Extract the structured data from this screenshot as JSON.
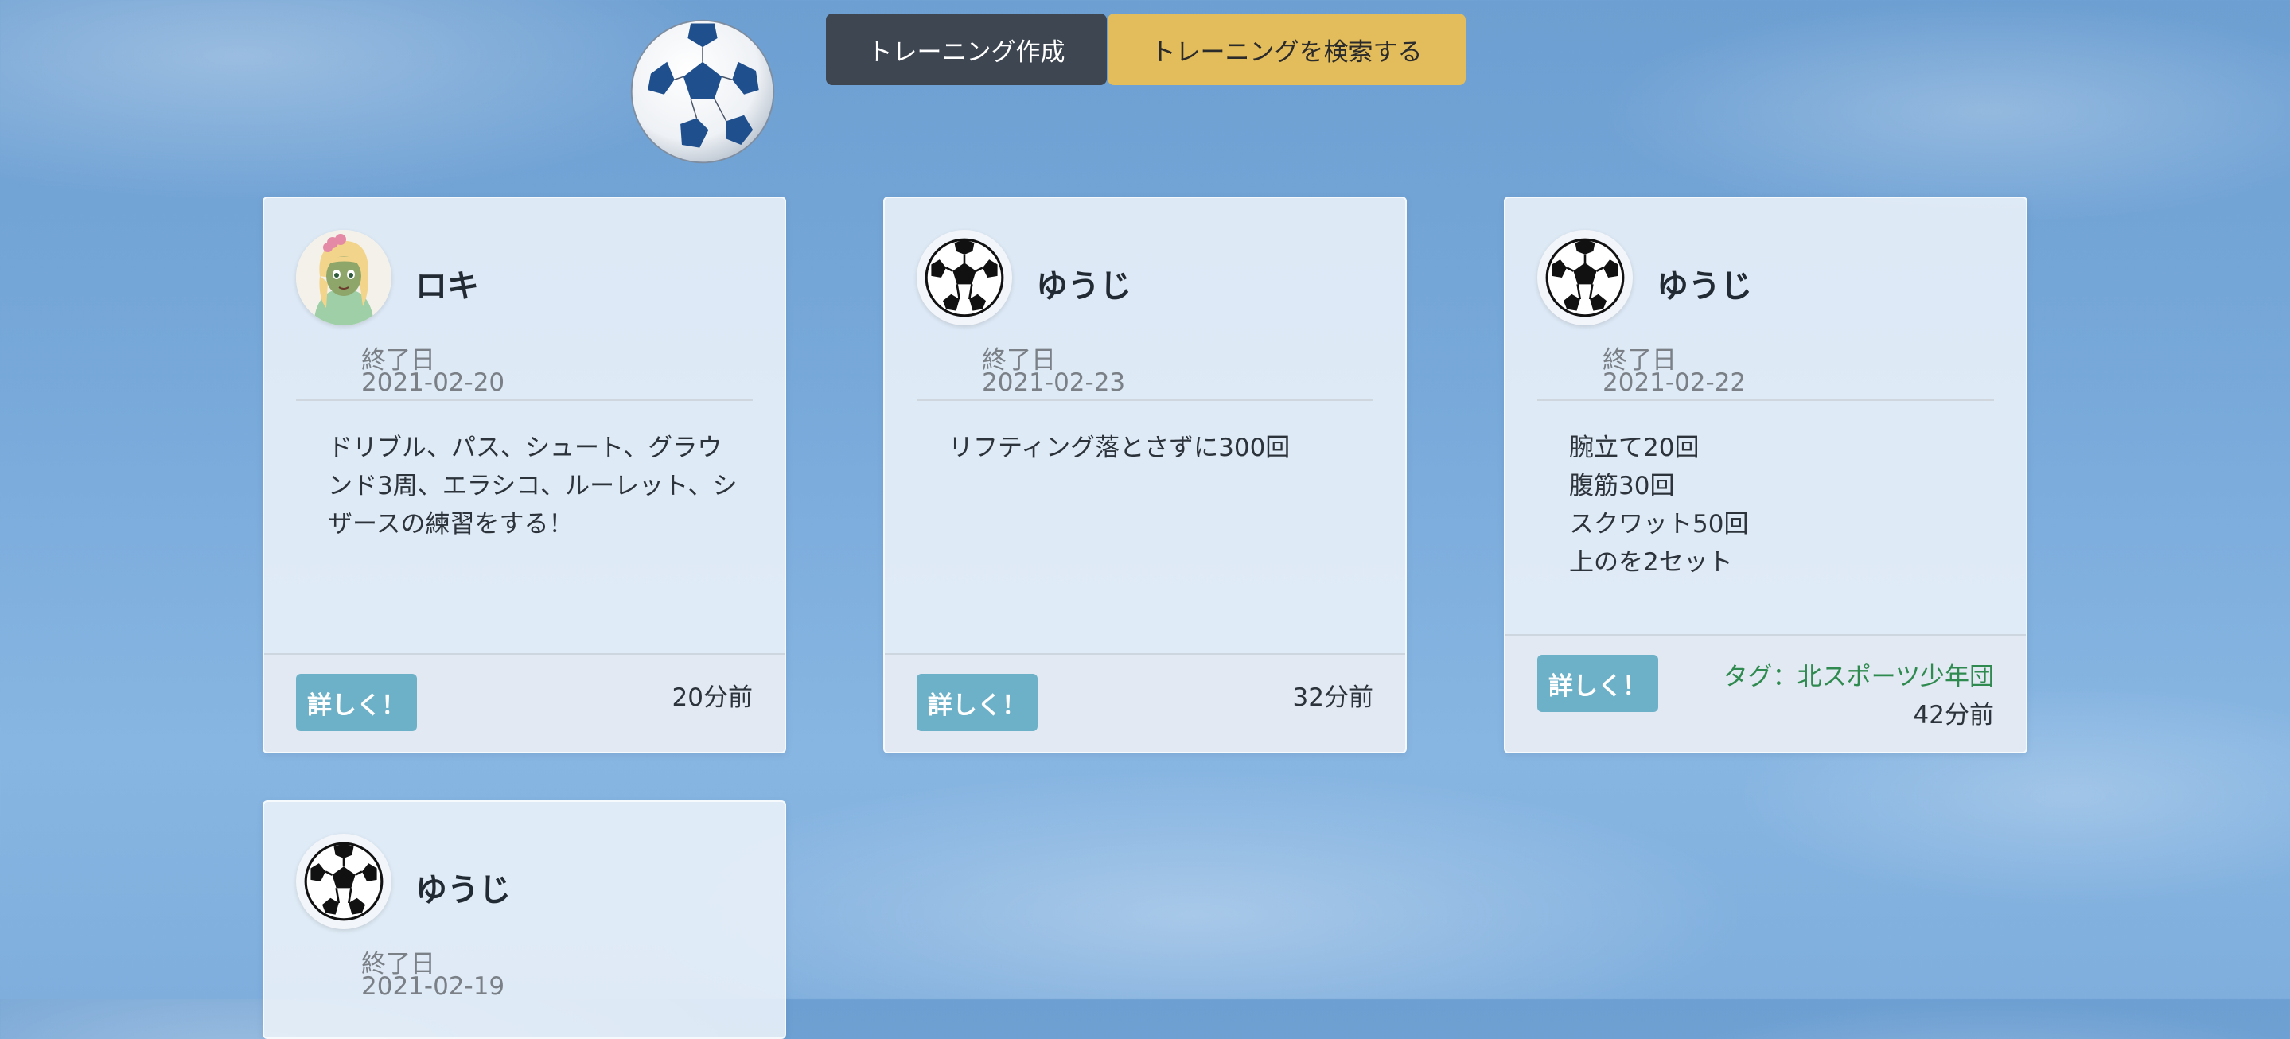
{
  "header": {
    "create_label": "トレーニング作成",
    "search_label": "トレーニングを検索する"
  },
  "cards": [
    {
      "username": "ロキ",
      "avatar": "anime-girl-avatar",
      "end_label": "終了日",
      "end_date": "2021-02-20",
      "body": "ドリブル、パス、シュート、グラウ\nンド3周、エラシコ、ルーレット、シ\nザースの練習をする！",
      "detail_label": "詳しく！",
      "time_ago": "20分前"
    },
    {
      "username": "ゆうじ",
      "avatar": "soccer-ball-avatar",
      "end_label": "終了日",
      "end_date": "2021-02-23",
      "body": "リフティング落とさずに300回",
      "detail_label": "詳しく！",
      "time_ago": "32分前"
    },
    {
      "username": "ゆうじ",
      "avatar": "soccer-ball-avatar",
      "end_label": "終了日",
      "end_date": "2021-02-22",
      "body": "腕立て20回\n腹筋30回\nスクワット50回\n上のを2セット",
      "detail_label": "詳しく！",
      "tag": "タグ：北スポーツ少年団",
      "time_ago": "42分前"
    },
    {
      "username": "ゆうじ",
      "avatar": "soccer-ball-avatar",
      "end_label": "終了日",
      "end_date": "2021-02-19"
    }
  ],
  "colors": {
    "create_button": "#3e4652",
    "search_button": "#e3bc5b",
    "detail_button": "#6db1c8",
    "tag_text": "#2f8a4f",
    "sky": "#78a9da"
  },
  "decor": {
    "sky_ball": "soccer-ball-icon"
  }
}
